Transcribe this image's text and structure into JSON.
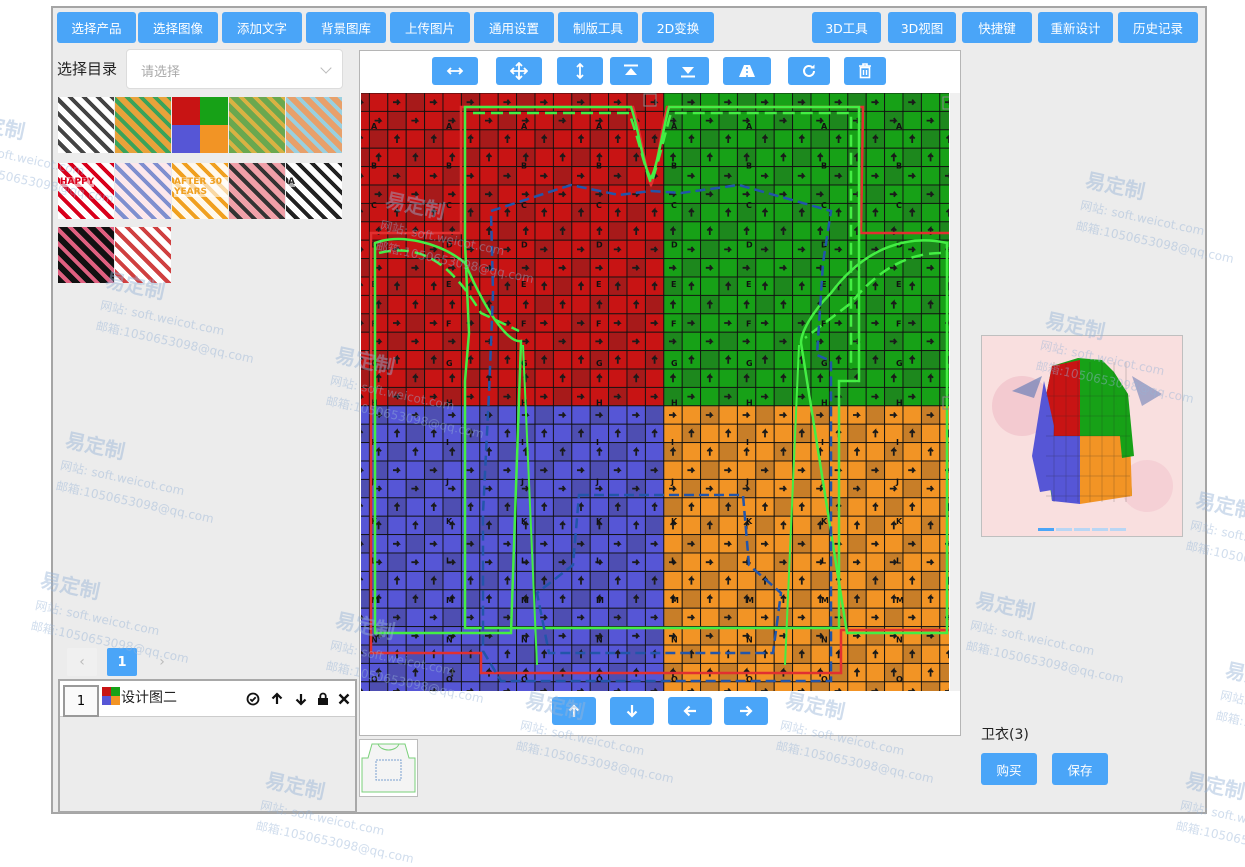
{
  "toolbar": {
    "left": [
      "选择产品",
      "选择图像",
      "添加文字",
      "背景图库",
      "上传图片",
      "通用设置",
      "制版工具",
      "2D变换"
    ],
    "right": [
      "3D工具",
      "3D视图",
      "快捷键",
      "重新设计",
      "历史记录"
    ]
  },
  "catalog": {
    "label": "选择目录",
    "placeholder": "请选择"
  },
  "thumbnails": [
    {
      "name": "doodle-pattern-thumb",
      "colors": [
        "#ffffff",
        "#444444"
      ],
      "text": ""
    },
    {
      "name": "mosaic-pattern-thumb",
      "colors": [
        "#e8a23a",
        "#3aa35a"
      ],
      "text": ""
    },
    {
      "name": "four-color-grid-thumb",
      "colors": [
        "#c81414",
        "#17a117",
        "#5656d6",
        "#f29425"
      ],
      "text": ""
    },
    {
      "name": "green-tile-thumb",
      "colors": [
        "#6aa84f",
        "#d9b243"
      ],
      "text": ""
    },
    {
      "name": "pastel-tile-thumb",
      "colors": [
        "#e8a06a",
        "#9ad0e0"
      ],
      "text": ""
    },
    {
      "name": "happy-card-thumb",
      "colors": [
        "#ffffff",
        "#d9001b"
      ],
      "text": "HAPPY"
    },
    {
      "name": "ribbon-thumb",
      "colors": [
        "#fde8ec",
        "#7f8fcf"
      ],
      "text": ""
    },
    {
      "name": "after-years-thumb",
      "colors": [
        "#fff8ec",
        "#f0a020"
      ],
      "text": "AFTER 30 YEARS"
    },
    {
      "name": "lamp-photo-thumb",
      "colors": [
        "#f0a0a8",
        "#333333"
      ],
      "text": ""
    },
    {
      "name": "letter-a-thumb",
      "colors": [
        "#ffffff",
        "#222222"
      ],
      "text": "A"
    },
    {
      "name": "floral-dark-thumb",
      "colors": [
        "#111111",
        "#e06080"
      ],
      "text": ""
    },
    {
      "name": "dancer-thumb",
      "colors": [
        "#ffffff",
        "#d04040"
      ],
      "text": ""
    }
  ],
  "pager": {
    "prev": "‹",
    "current": "1",
    "next": "›"
  },
  "layer": {
    "index": "1",
    "name": "设计图二",
    "swatch": [
      "#c81414",
      "#17a117",
      "#5656d6",
      "#f29425"
    ]
  },
  "grid": {
    "rows": [
      "A",
      "B",
      "C",
      "D",
      "E",
      "F",
      "G",
      "H",
      "I",
      "J",
      "K",
      "L",
      "M",
      "N",
      "O"
    ],
    "quadrants": {
      "top_left": "#c81414",
      "top_right": "#17a117",
      "bottom_left": "#5656d6",
      "bottom_right": "#f29425"
    }
  },
  "preview": {
    "caption": "卫衣(3)"
  },
  "actions": {
    "buy": "购买",
    "save": "保存"
  },
  "watermark": {
    "brand": "易定制",
    "site": "网站: soft.weicot.com",
    "email": "邮箱:1050653098@qq.com"
  },
  "colors": {
    "accent": "#4aa5f8",
    "panel": "#ececec",
    "cut_line": "#44ee44",
    "dash": "#2255aa"
  }
}
